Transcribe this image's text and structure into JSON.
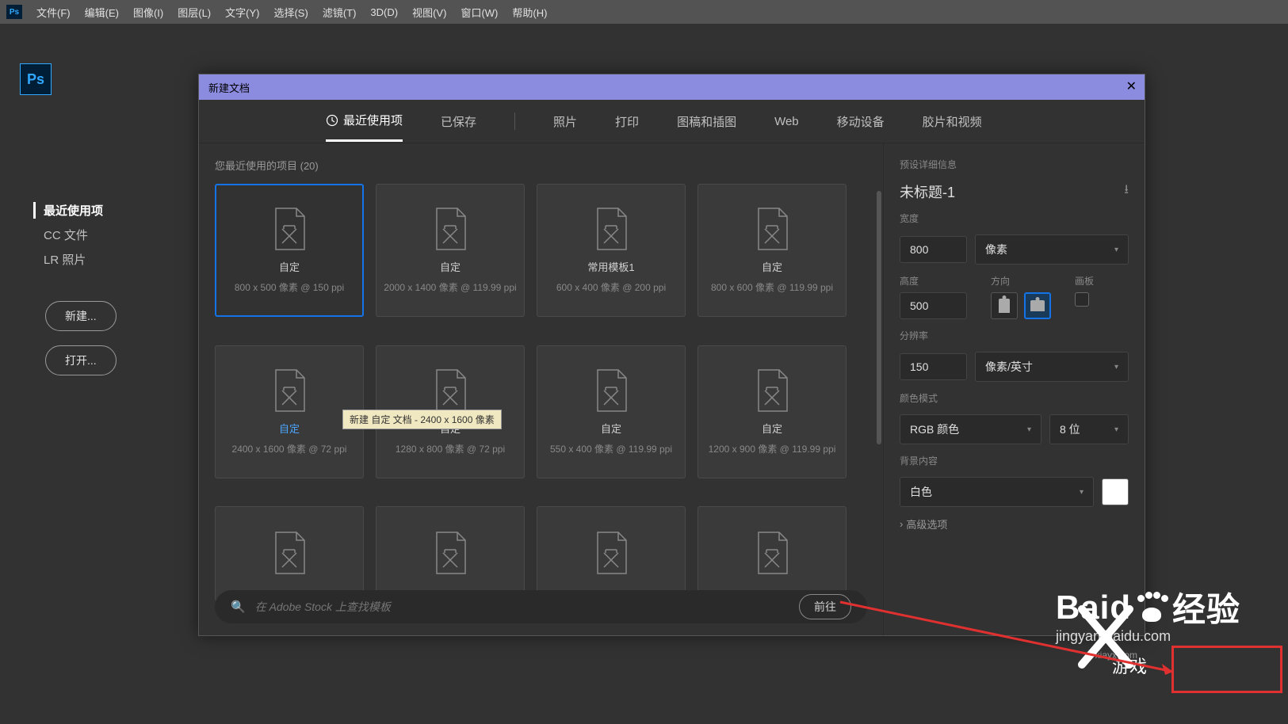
{
  "menubar": {
    "items": [
      "文件(F)",
      "编辑(E)",
      "图像(I)",
      "图层(L)",
      "文字(Y)",
      "选择(S)",
      "滤镜(T)",
      "3D(D)",
      "视图(V)",
      "窗口(W)",
      "帮助(H)"
    ]
  },
  "ps_label": "Ps",
  "sidebar": {
    "items": [
      "最近使用项",
      "CC 文件",
      "LR 照片"
    ],
    "new_btn": "新建...",
    "open_btn": "打开..."
  },
  "dialog": {
    "title": "新建文档",
    "close": "✕",
    "tabs": [
      "最近使用项",
      "已保存",
      "照片",
      "打印",
      "图稿和插图",
      "Web",
      "移动设备",
      "胶片和视频"
    ],
    "recent_label": "您最近使用的项目  (20)",
    "tooltip": "新建 自定 文档 - 2400 x 1600 像素",
    "presets": [
      {
        "name": "自定",
        "info": "800 x 500 像素 @ 150 ppi",
        "selected": true
      },
      {
        "name": "自定",
        "info": "2000 x 1400 像素 @ 119.99 ppi"
      },
      {
        "name": "常用模板1",
        "info": "600 x 400 像素 @ 200 ppi"
      },
      {
        "name": "自定",
        "info": "800 x 600 像素 @ 119.99 ppi"
      },
      {
        "name": "自定",
        "info": "2400 x 1600 像素 @ 72 ppi",
        "hl": true
      },
      {
        "name": "自定",
        "info": "1280 x 800 像素 @ 72 ppi"
      },
      {
        "name": "自定",
        "info": "550 x 400 像素 @ 119.99 ppi"
      },
      {
        "name": "自定",
        "info": "1200 x 900 像素 @ 119.99 ppi"
      },
      {
        "name": "",
        "info": ""
      },
      {
        "name": "",
        "info": ""
      },
      {
        "name": "",
        "info": ""
      },
      {
        "name": "",
        "info": ""
      }
    ],
    "search": {
      "placeholder": "在 Adobe Stock 上查找模板",
      "go": "前往"
    }
  },
  "right": {
    "header": "预设详细信息",
    "title": "未标题-1",
    "width_label": "宽度",
    "width_value": "800",
    "unit": "像素",
    "height_label": "高度",
    "height_value": "500",
    "orient_label": "方向",
    "artboard_label": "画板",
    "res_label": "分辨率",
    "res_value": "150",
    "res_unit": "像素/英寸",
    "color_label": "颜色模式",
    "color_mode": "RGB 颜色",
    "bit_depth": "8 位",
    "bg_label": "背景内容",
    "bg_value": "白色",
    "advanced": "高级选项"
  },
  "watermark": {
    "brand": "Baid",
    "suffix": "经验",
    "sub": "jingyan.baidu.com",
    "xia_url": "xiayx.com",
    "xia_text": "游戏"
  }
}
